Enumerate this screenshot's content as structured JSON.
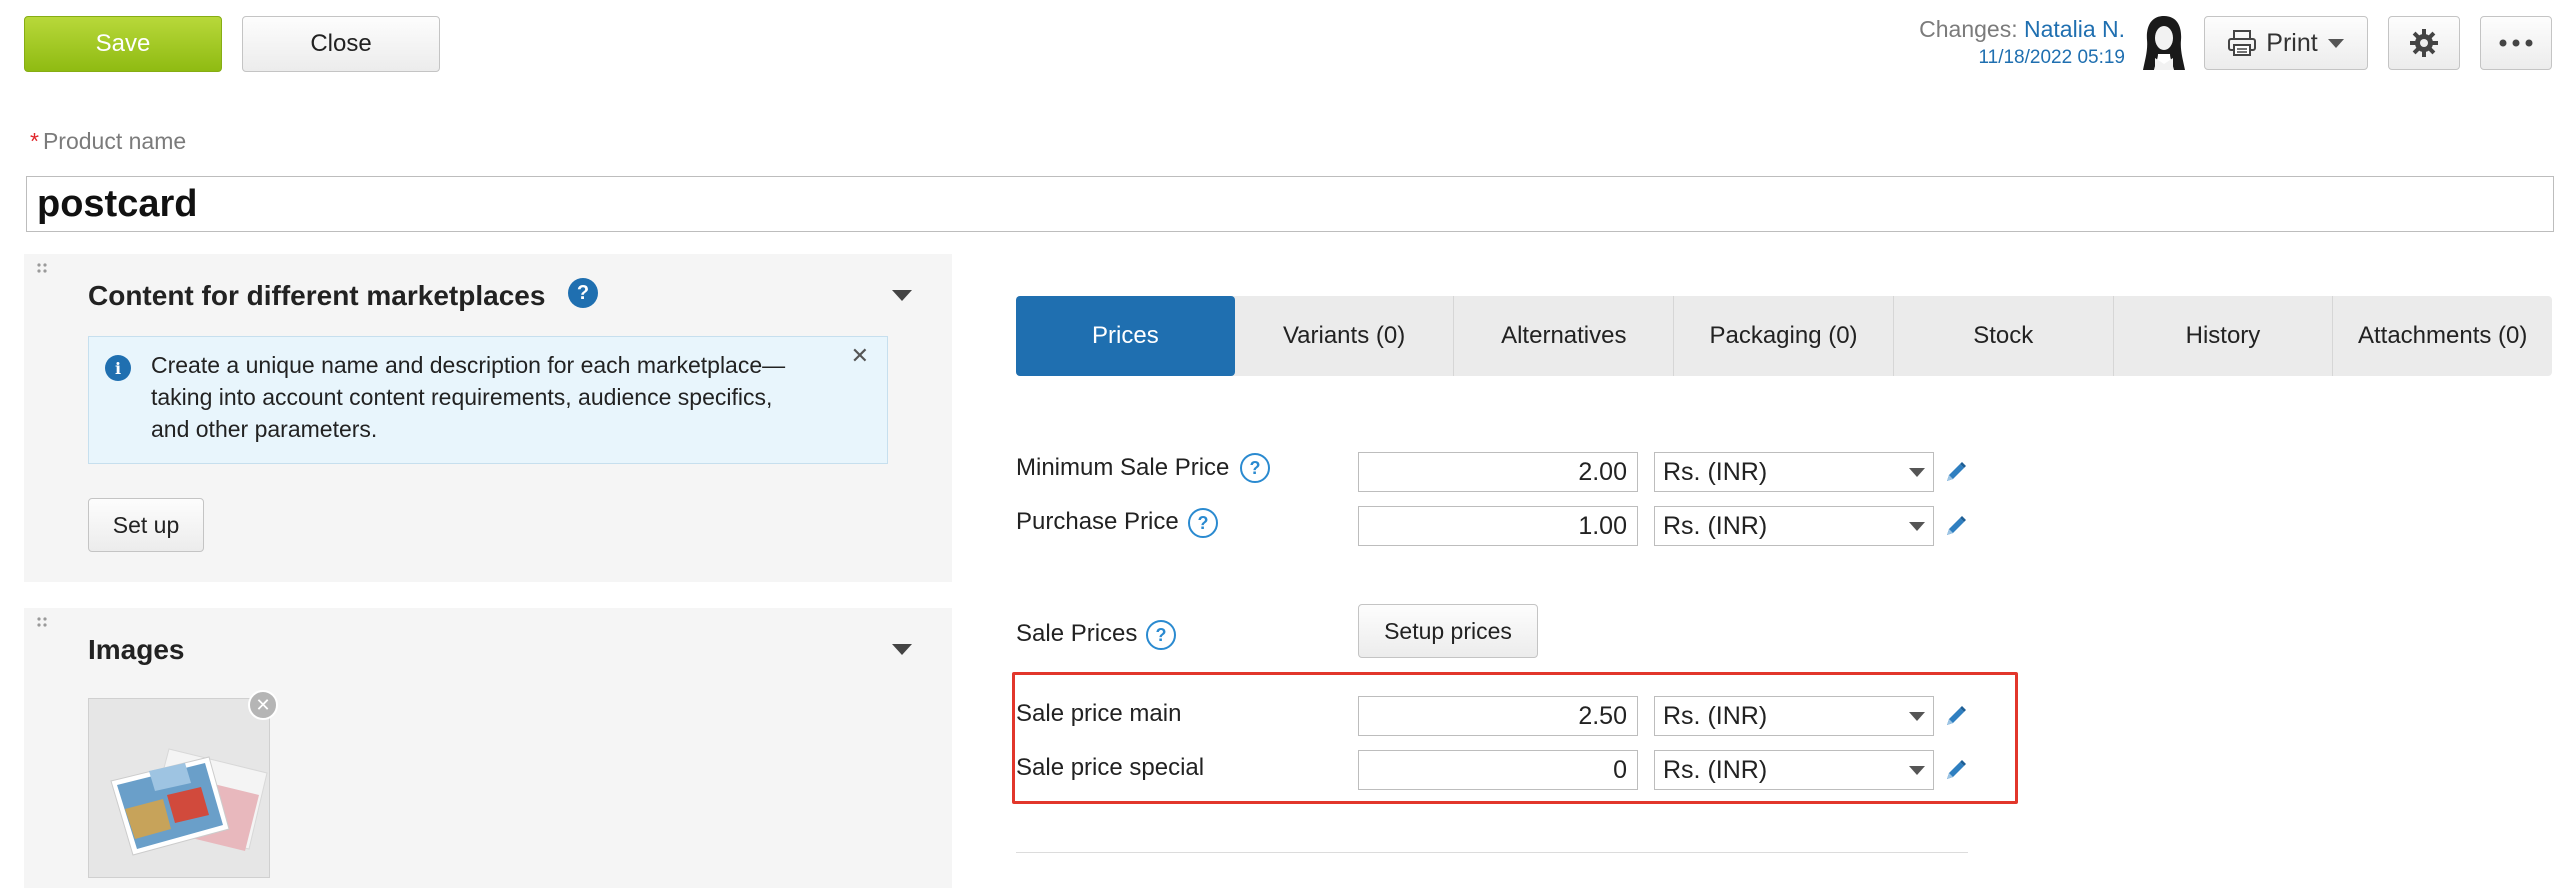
{
  "toolbar": {
    "save_label": "Save",
    "close_label": "Close",
    "changes_label": "Changes:",
    "changes_user": "Natalia N.",
    "changes_date": "11/18/2022 05:19",
    "print_label": "Print"
  },
  "product": {
    "name_label": "Product name",
    "name_value": "postcard"
  },
  "marketplaces": {
    "title": "Content for different marketplaces",
    "info_text": "Create a unique name and description for each marketplace—taking into account content requirements, audience specifics, and other parameters.",
    "setup_label": "Set up"
  },
  "images": {
    "title": "Images"
  },
  "tabs": [
    {
      "label": "Prices",
      "active": true
    },
    {
      "label": "Variants (0)"
    },
    {
      "label": "Alternatives"
    },
    {
      "label": "Packaging (0)"
    },
    {
      "label": "Stock"
    },
    {
      "label": "History"
    },
    {
      "label": "Attachments (0)"
    }
  ],
  "prices": {
    "min_sale": {
      "label": "Minimum Sale Price",
      "value": "2.00",
      "currency": "Rs. (INR)"
    },
    "purchase": {
      "label": "Purchase Price",
      "value": "1.00",
      "currency": "Rs. (INR)"
    },
    "sale_prices_label": "Sale Prices",
    "setup_prices_label": "Setup prices",
    "sale_main": {
      "label": "Sale price main",
      "value": "2.50",
      "currency": "Rs. (INR)"
    },
    "sale_special": {
      "label": "Sale price special",
      "value": "0",
      "currency": "Rs. (INR)"
    }
  },
  "colors": {
    "accent": "#1f6fb0",
    "save_green": "#9cc51f",
    "highlight_red": "#e2362b"
  },
  "icons": [
    "avatar-icon",
    "printer-icon",
    "gear-icon",
    "more-icon",
    "drag-handle-icon",
    "help-icon",
    "info-icon",
    "close-icon",
    "caret-down-icon",
    "pencil-icon"
  ]
}
